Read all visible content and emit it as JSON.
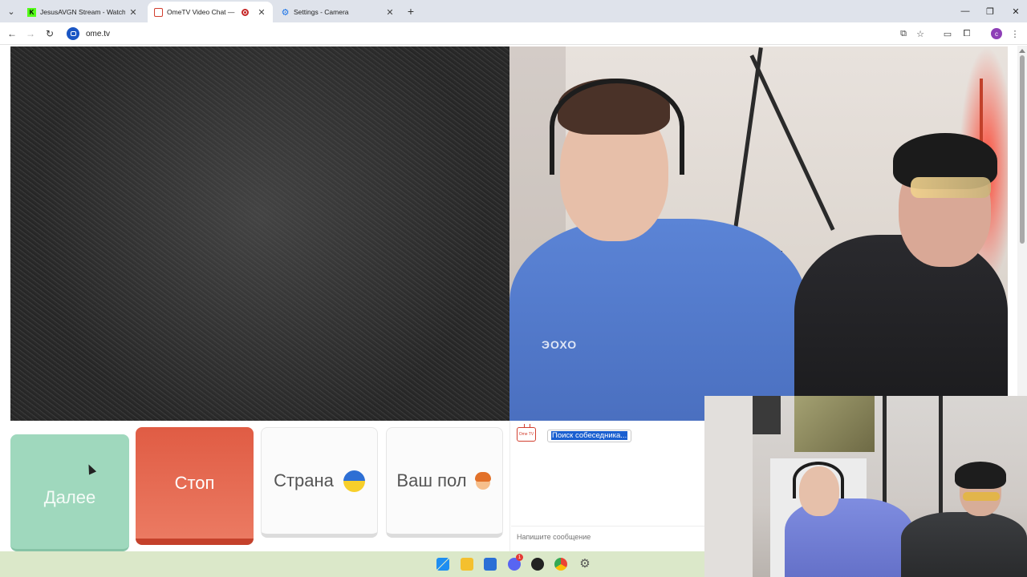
{
  "browser": {
    "tabs": [
      {
        "title": "JesusAVGN Stream - Watch Live",
        "favicon": "kick-icon",
        "favicon_color": "#53fc18",
        "active": false
      },
      {
        "title": "OmeTV Video Chat — Ome",
        "favicon": "ometv-icon",
        "favicon_color": "#d23f2f",
        "active": true,
        "recording": true
      },
      {
        "title": "Settings - Camera",
        "favicon": "gear-icon",
        "favicon_color": "#1a73e8",
        "active": false
      }
    ],
    "new_tab_symbol": "+",
    "url": "ome.tv",
    "profile_initial": "c"
  },
  "controls": {
    "next_label": "Далее",
    "stop_label": "Стоп",
    "country_label": "Страна",
    "gender_label": "Ваш пол",
    "next_color": "#9fd8bd",
    "stop_color": "#e05c44"
  },
  "chat": {
    "logo_text": "Ome TV",
    "status_text": "Поиск собеседника...",
    "input_placeholder": "Напишите сообщение"
  },
  "remote_video": {
    "shirt_text": "ЭОХО"
  },
  "taskbar": {
    "apps": [
      "windows-start-icon",
      "file-explorer-icon",
      "store-icon",
      "discord-icon",
      "app-icon",
      "chrome-icon",
      "settings-icon"
    ],
    "discord_badge": "1"
  }
}
